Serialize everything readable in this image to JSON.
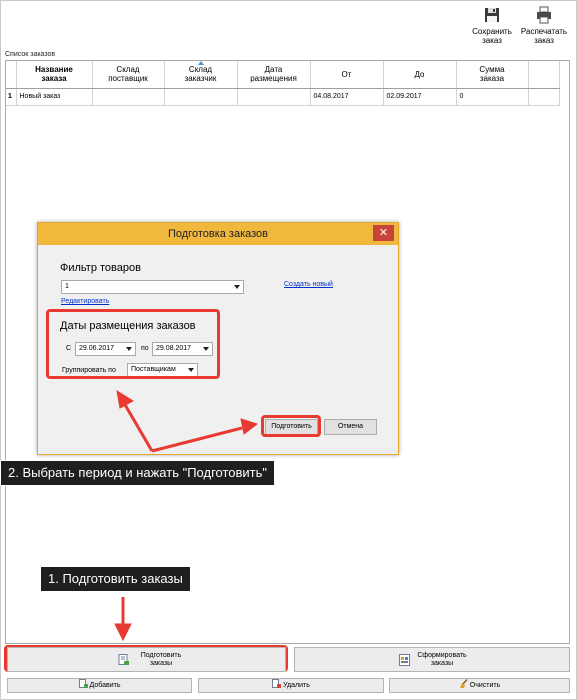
{
  "toolbar": {
    "save": {
      "line1": "Сохранить",
      "line2": "заказ",
      "icon": "floppy-disk-icon"
    },
    "print": {
      "line1": "Распечатать",
      "line2": "заказ",
      "icon": "printer-icon"
    }
  },
  "orders": {
    "section_label": "Список заказов",
    "columns": [
      {
        "line1": "Название",
        "line2": "заказа"
      },
      {
        "line1": "Склад",
        "line2": "поставщик"
      },
      {
        "line1": "Склад",
        "line2": "заказчик"
      },
      {
        "line1": "Дата",
        "line2": "размещения"
      },
      {
        "line1": "От",
        "line2": ""
      },
      {
        "line1": "До",
        "line2": ""
      },
      {
        "line1": "Сумма",
        "line2": "заказа"
      }
    ],
    "rows": [
      {
        "num": "1",
        "name": "Новый заказ",
        "supplier": "",
        "customer": "",
        "placed": "",
        "from": "04.08.2017",
        "to": "02.09.2017",
        "sum": "0"
      }
    ]
  },
  "dialog": {
    "title": "Подготовка заказов",
    "close_glyph": "✕",
    "filter_heading": "Фильтр товаров",
    "filter_value": "1",
    "create_link": "Создать новый",
    "edit_link": "Редактировать",
    "dates_heading": "Даты размещения заказов",
    "from_label": "С",
    "from_value": "29.06.2017",
    "to_label": "по",
    "to_value": "29.08.2017",
    "group_label": "Группировать по",
    "group_value": "Поставщикам",
    "prepare_button": "Подготовить",
    "cancel_button": "Отмена"
  },
  "annotations": {
    "step2": "2. Выбрать период и нажать \"Подготовить\"",
    "step1": "1. Подготовить заказы",
    "color": "#e83a30"
  },
  "bottom": {
    "prepare": {
      "line1": "Подготовить",
      "line2": "заказы",
      "icon": "prepare-orders-icon"
    },
    "form": {
      "line1": "Сформировать",
      "line2": "заказы",
      "icon": "form-orders-icon"
    },
    "add": {
      "label": "Добавить",
      "icon": "add-doc-icon"
    },
    "delete": {
      "label": "Удалить",
      "icon": "delete-doc-icon"
    },
    "clear": {
      "label": "Очистить",
      "icon": "broom-icon"
    }
  }
}
